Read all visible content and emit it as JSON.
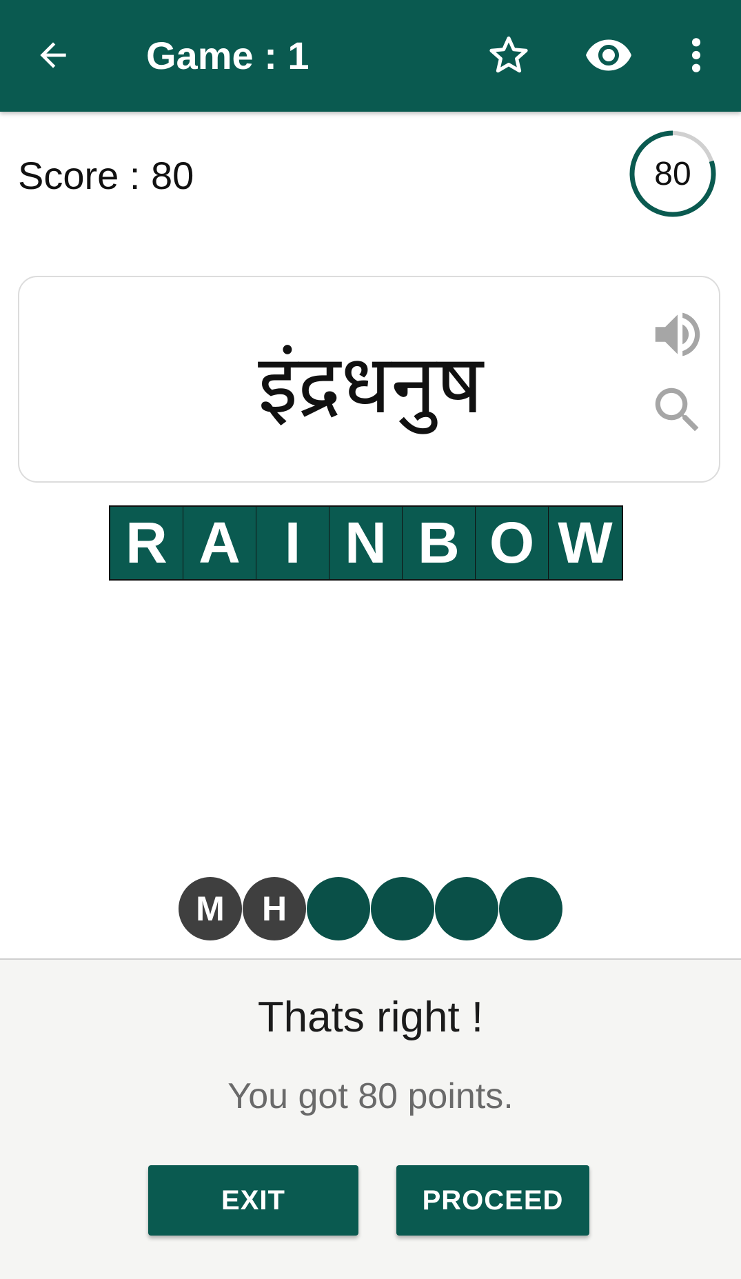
{
  "appbar": {
    "title": "Game : 1",
    "back_icon": "arrow-left-icon",
    "star_icon": "star-outline-icon",
    "eye_icon": "eye-icon",
    "more_icon": "more-vertical-icon"
  },
  "score": {
    "label": "Score : 80",
    "ring_value": "80",
    "ring_fraction": 0.8
  },
  "card": {
    "word": "इंद्रधनुष",
    "speaker_icon": "speaker-icon",
    "search_icon": "search-icon"
  },
  "answer": {
    "letters": [
      "R",
      "A",
      "I",
      "N",
      "B",
      "O",
      "W"
    ]
  },
  "hints": [
    {
      "label": "M",
      "state": "used"
    },
    {
      "label": "H",
      "state": "used"
    },
    {
      "label": "",
      "state": "open"
    },
    {
      "label": "",
      "state": "open"
    },
    {
      "label": "",
      "state": "open"
    },
    {
      "label": "",
      "state": "open"
    }
  ],
  "result": {
    "title": "Thats right !",
    "message": "You got 80 points.",
    "exit_label": "EXIT",
    "proceed_label": "PROCEED"
  },
  "colors": {
    "primary": "#0a5a50",
    "tile": "#0a5a50",
    "hint_used": "#3f3f3f",
    "ring_track": "#d0d0d0"
  }
}
